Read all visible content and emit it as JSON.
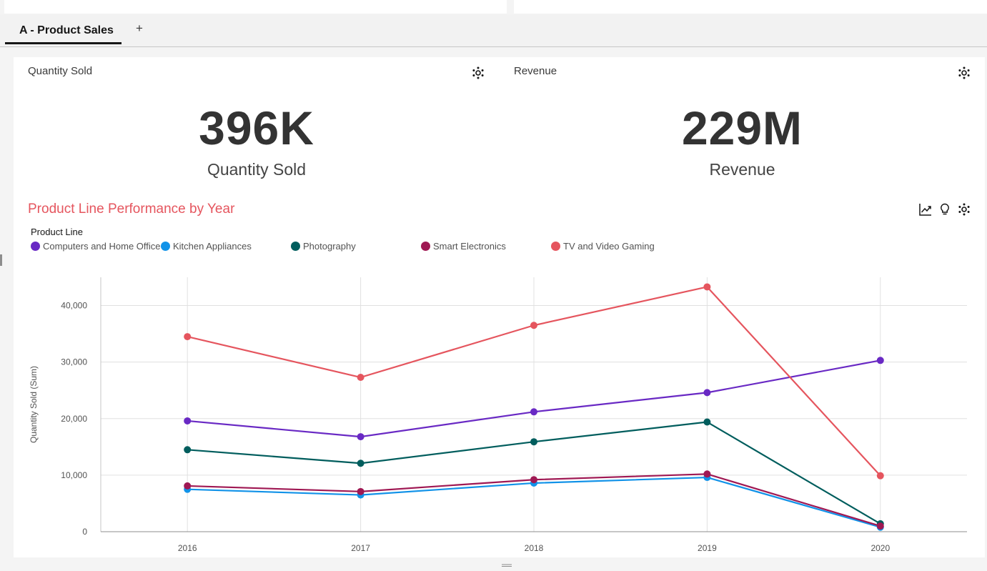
{
  "tabs": [
    {
      "label": "A - Product Sales",
      "active": true
    }
  ],
  "tab_add_label": "+",
  "kpis": [
    {
      "title": "Quantity Sold",
      "value": "396K",
      "label": "Quantity Sold"
    },
    {
      "title": "Revenue",
      "value": "229M",
      "label": "Revenue"
    }
  ],
  "chart_panel": {
    "title": "Product Line Performance by Year",
    "legend_title": "Product Line"
  },
  "icons": {
    "settings": "gear-icon",
    "chart_type": "line-chart-icon",
    "insights": "lightbulb-icon"
  },
  "chart_data": {
    "type": "line",
    "title": "Product Line Performance by Year",
    "x": [
      "2016",
      "2017",
      "2018",
      "2019",
      "2020"
    ],
    "xlabel": "",
    "ylabel": "Quantity Sold (Sum)",
    "ylim": [
      0,
      45000
    ],
    "yticks": [
      0,
      10000,
      20000,
      30000,
      40000
    ],
    "ytick_labels": [
      "0",
      "10,000",
      "20,000",
      "30,000",
      "40,000"
    ],
    "grid": true,
    "legend_title": "Product Line",
    "legend_position": "top-left",
    "series": [
      {
        "name": "Computers and Home Office",
        "color": "#6929c4",
        "values": [
          19600,
          16800,
          21200,
          24600,
          30300
        ]
      },
      {
        "name": "Kitchen Appliances",
        "color": "#1192e8",
        "values": [
          7500,
          6500,
          8600,
          9600,
          800
        ]
      },
      {
        "name": "Photography",
        "color": "#005d5d",
        "values": [
          14500,
          12100,
          15900,
          19400,
          1400
        ]
      },
      {
        "name": "Smart Electronics",
        "color": "#9f1853",
        "values": [
          8100,
          7100,
          9200,
          10200,
          1000
        ]
      },
      {
        "name": "TV and Video Gaming",
        "color": "#e5555e",
        "values": [
          34500,
          27300,
          36500,
          43300,
          9900
        ]
      }
    ]
  }
}
